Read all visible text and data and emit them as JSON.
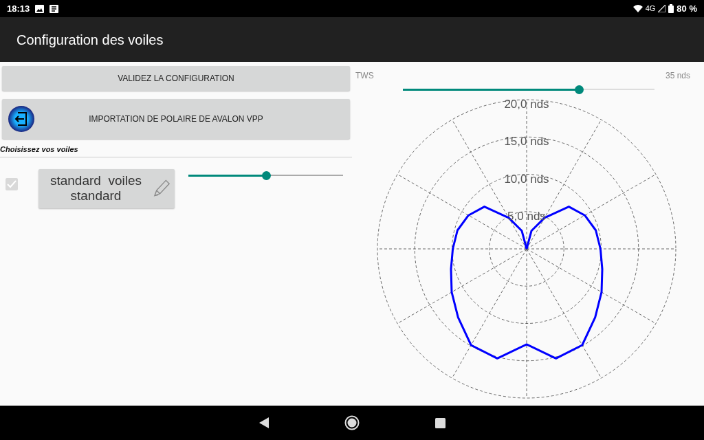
{
  "status_bar": {
    "time": "18:13",
    "network": "4G",
    "battery": "80 %"
  },
  "app_bar": {
    "title": "Configuration des voiles"
  },
  "buttons": [
    {
      "label": "VALIDEZ LA CONFIGURATION",
      "kind": "plain"
    },
    {
      "label": "IMPORTATION DE POLAIRE DE AVALON VPP",
      "kind": "import"
    }
  ],
  "section_title": "Choisissez vos voiles",
  "sails": [
    {
      "checked": true,
      "disabled": true,
      "name": "standard  voiles standard",
      "level": 0.5
    }
  ],
  "tws": {
    "label": "TWS",
    "level": 0.7,
    "reading": "35 nds"
  },
  "polar": {
    "ring_labels": [
      "20,0 nds",
      "15,0 nds",
      "10,0 nds",
      "5,0 nds"
    ]
  }
}
